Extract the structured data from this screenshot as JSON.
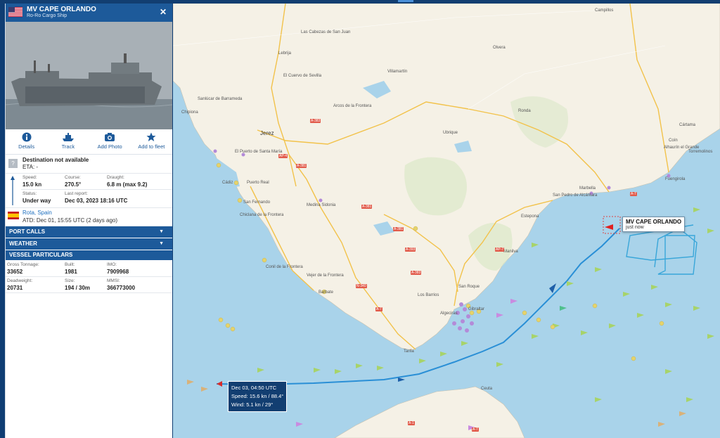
{
  "vessel": {
    "name": "MV CAPE ORLANDO",
    "type": "Ro-Ro Cargo Ship",
    "flag": "United States",
    "destination_label": "Destination not available",
    "eta": "ETA: -",
    "speed_label": "Speed:",
    "speed": "15.0 kn",
    "course_label": "Course:",
    "course": "270.5°",
    "draught_label": "Draught:",
    "draught": "6.8 m (max 9.2)",
    "status_label": "Status:",
    "status": "Under way",
    "last_report_label": "Last report:",
    "last_report": "Dec 03, 2023 18:16 UTC",
    "port": "Rota, Spain",
    "atd": "ATD: Dec 01, 15:55 UTC (2 days ago)"
  },
  "actions": [
    "Details",
    "Track",
    "Add Photo",
    "Add to fleet"
  ],
  "sections": [
    "PORT CALLS",
    "WEATHER",
    "VESSEL PARTICULARS"
  ],
  "particulars": {
    "gross_tonnage_label": "Gross Tonnage:",
    "gross_tonnage": "33652",
    "built_label": "Built:",
    "built": "1981",
    "imo_label": "IMO:",
    "imo": "7909968",
    "deadweight_label": "Deadweight:",
    "deadweight": "20731",
    "size_label": "Size:",
    "size": "194 / 30m",
    "mmsi_label": "MMSI:",
    "mmsi": "366773000"
  },
  "map": {
    "ship_label": "MV CAPE ORLANDO",
    "ship_time": "just now",
    "track_tip": {
      "time": "Dec 03, 04:50 UTC",
      "speed": "Speed: 15.6 kn / 88.4°",
      "wind": "Wind: 5.1 kn / 29°"
    },
    "places": {
      "lebrija": "Lebrija",
      "cabezas": "Las Cabezas de San Juan",
      "villamartin": "Villamartín",
      "cuervo": "El Cuervo de Sevilla",
      "arcos": "Arcos de la Frontera",
      "olvera": "Olvera",
      "sanlucar": "Sanlúcar de Barrameda",
      "chipiona": "Chipiona",
      "jerez": "Jerez",
      "puerto": "El Puerto de Santa María",
      "cadiz": "Cádiz",
      "sanfernando": "San Fernando",
      "puertoreal": "Puerto Real",
      "ubrique": "Ubrique",
      "ronda": "Ronda",
      "campillos": "Campillos",
      "chiclana": "Chiclana de la Frontera",
      "medina": "Medina Sidonia",
      "conil": "Conil de la Frontera",
      "vejer": "Vejer de la Frontera",
      "barbate": "Barbate",
      "tarifa": "Tarifa",
      "algeciras": "Algeciras",
      "gibraltar": "Gibraltar",
      "barrios": "Los Barrios",
      "sanroque": "San Roque",
      "marbella": "Marbella",
      "sanpedro": "San Pedro de Alcántara",
      "estepona": "Estepona",
      "fuengirola": "Fuengirola",
      "cartama": "Cártama",
      "coin": "Coín",
      "alhaurin": "Alhaurín el Grande",
      "torremolinos": "Torremolinos",
      "ceuta": "Ceuta",
      "manilva": "Manilva"
    },
    "roads": [
      "A-383",
      "AP-4",
      "A-381",
      "A-381",
      "A-393",
      "A-381",
      "A-7",
      "AP-7",
      "A-383",
      "N-340",
      "A-7",
      "A-1",
      "A-7"
    ]
  }
}
